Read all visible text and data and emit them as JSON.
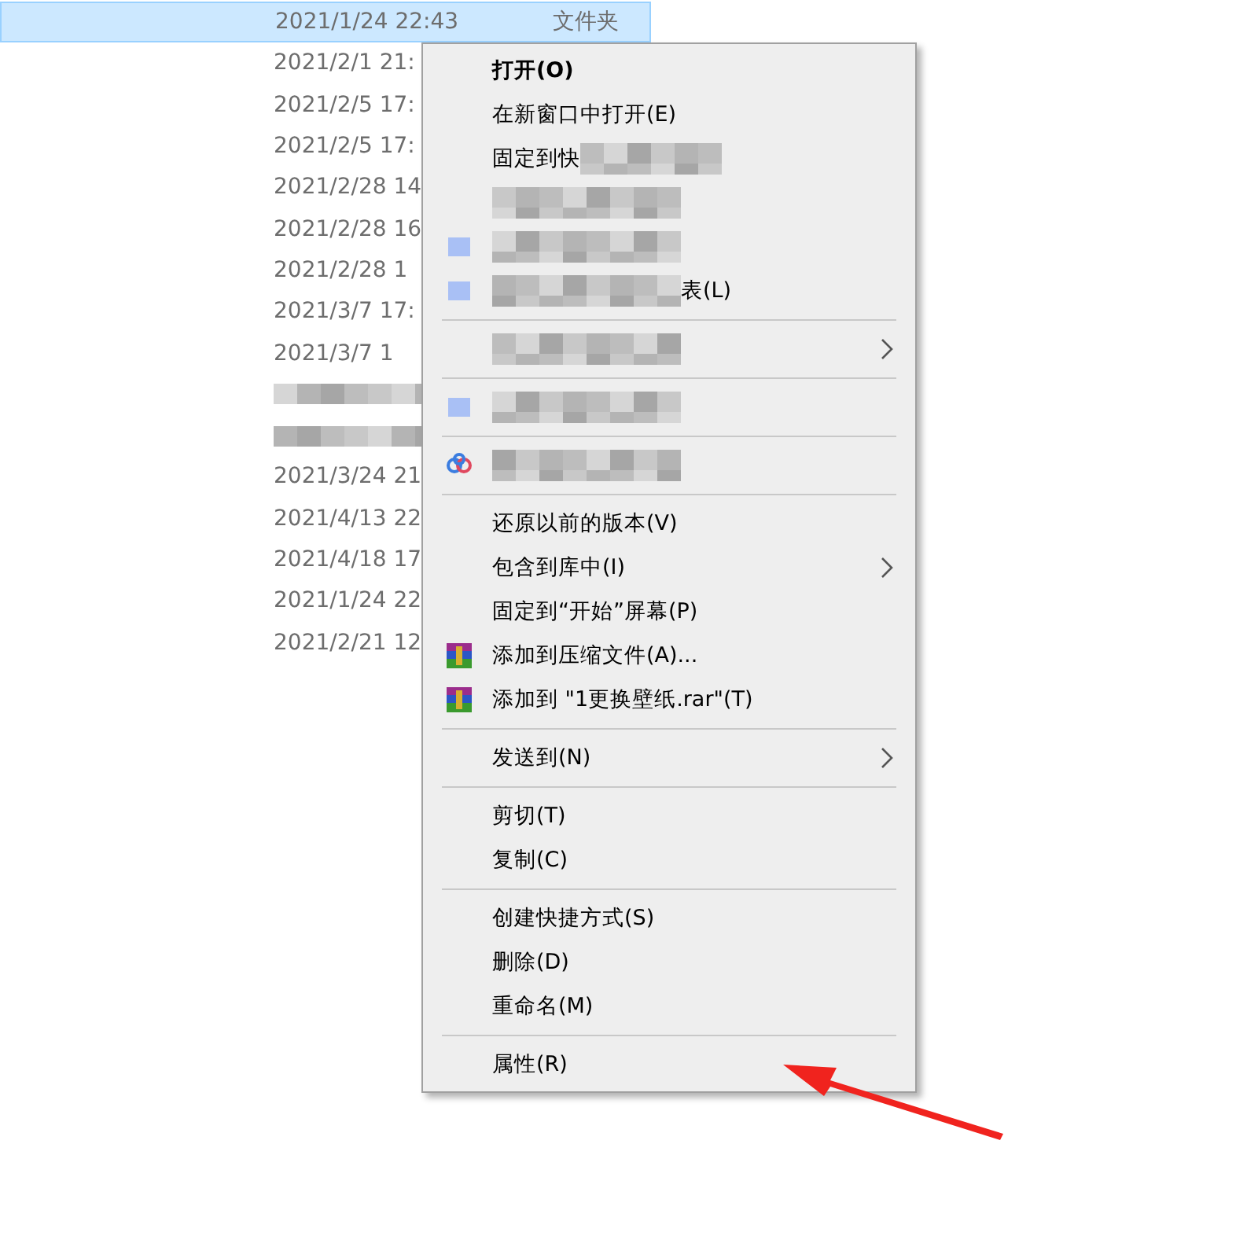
{
  "file_list": {
    "rows": [
      {
        "date": "2021/1/24 22:43",
        "type": "文件夹",
        "selected": true
      },
      {
        "date": "2021/2/1 21:",
        "selected": false
      },
      {
        "date": "2021/2/5 17:",
        "selected": false
      },
      {
        "date": "2021/2/5 17:",
        "selected": false
      },
      {
        "date": "2021/2/28 14",
        "selected": false
      },
      {
        "date": "2021/2/28 16",
        "selected": false
      },
      {
        "date": "2021/2/28 1",
        "selected": false
      },
      {
        "date": "2021/3/7 17:",
        "selected": false
      },
      {
        "date": "2021/3/7 1",
        "selected": false
      },
      {
        "kind": "blurred",
        "selected": false
      },
      {
        "kind": "blurred",
        "selected": false
      },
      {
        "date": "2021/3/24 21",
        "selected": false
      },
      {
        "date": "2021/4/13 22",
        "selected": false
      },
      {
        "date": "2021/4/18 17",
        "selected": false
      },
      {
        "date": "2021/1/24 22",
        "selected": false
      },
      {
        "date": "2021/2/21 12",
        "selected": false
      }
    ]
  },
  "context_menu": {
    "items": [
      {
        "kind": "item",
        "label": "打开(O)",
        "default": true
      },
      {
        "kind": "item",
        "label": "在新窗口中打开(E)",
        "default": false
      },
      {
        "kind": "redacted",
        "prefix": "固定到快"
      },
      {
        "kind": "redacted"
      },
      {
        "kind": "redacted"
      },
      {
        "kind": "redacted",
        "suffix": "表(L)"
      },
      {
        "kind": "separator"
      },
      {
        "kind": "redacted",
        "submenu": true
      },
      {
        "kind": "separator"
      },
      {
        "kind": "redacted"
      },
      {
        "kind": "separator"
      },
      {
        "kind": "redacted"
      },
      {
        "kind": "separator"
      },
      {
        "kind": "item",
        "label": "还原以前的版本(V)",
        "default": false
      },
      {
        "kind": "item",
        "label": "包含到库中(I)",
        "default": false,
        "submenu": true
      },
      {
        "kind": "item",
        "label": "固定到“开始”屏幕(P)",
        "default": false
      },
      {
        "kind": "item",
        "label": "添加到压缩文件(A)...",
        "default": false
      },
      {
        "kind": "item",
        "label": "添加到 \"1更换壁纸.rar\"(T)",
        "default": false
      },
      {
        "kind": "separator"
      },
      {
        "kind": "item",
        "label": "发送到(N)",
        "default": false,
        "submenu": true
      },
      {
        "kind": "separator"
      },
      {
        "kind": "item",
        "label": "剪切(T)",
        "default": false
      },
      {
        "kind": "item",
        "label": "复制(C)",
        "default": false
      },
      {
        "kind": "separator"
      },
      {
        "kind": "item",
        "label": "创建快捷方式(S)",
        "default": false
      },
      {
        "kind": "item",
        "label": "删除(D)",
        "default": false
      },
      {
        "kind": "item",
        "label": "重命名(M)",
        "default": false
      },
      {
        "kind": "separator"
      },
      {
        "kind": "item",
        "label": "属性(R)",
        "default": false
      }
    ]
  }
}
